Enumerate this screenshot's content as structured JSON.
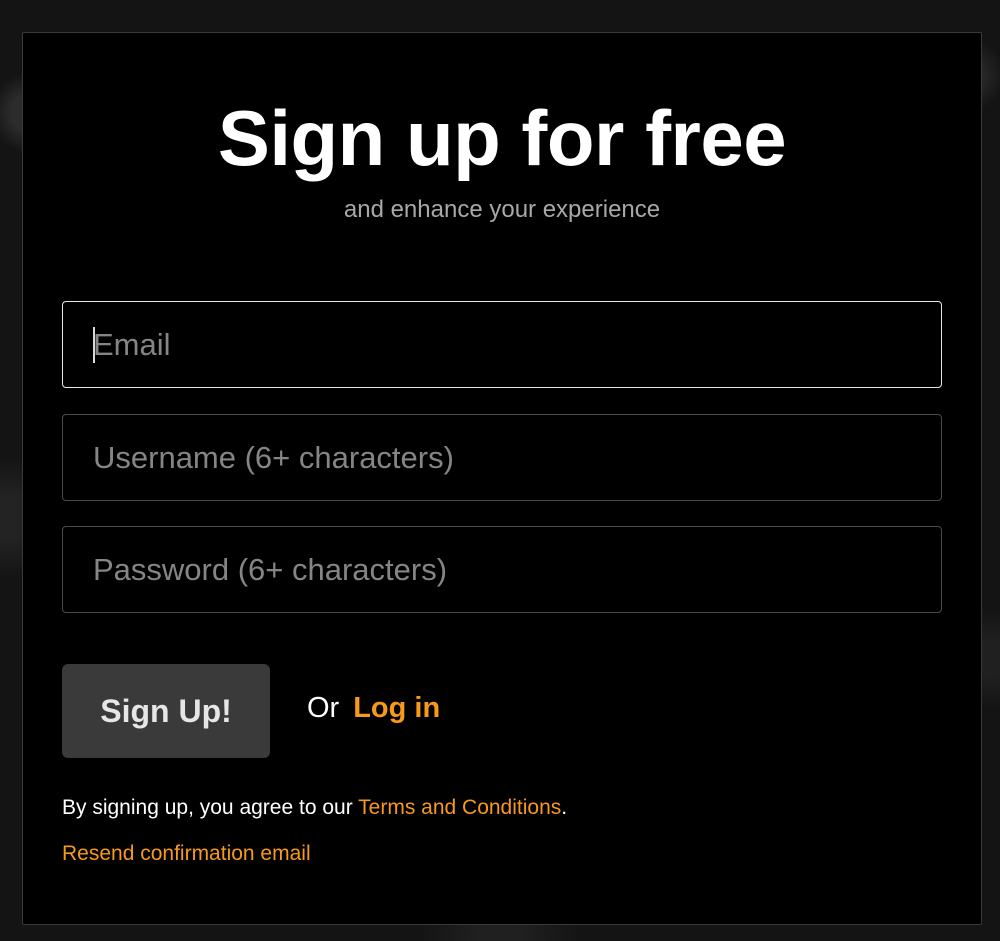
{
  "heading": {
    "title": "Sign up for free",
    "subtitle": "and enhance your experience"
  },
  "form": {
    "email_placeholder": "Email",
    "username_placeholder": "Username (6+ characters)",
    "password_placeholder": "Password (6+ characters)",
    "submit_label": "Sign Up!",
    "or_text": "Or",
    "login_label": "Log in"
  },
  "footer": {
    "terms_prefix": "By signing up, you agree to our ",
    "terms_link": "Terms and Conditions",
    "terms_suffix": ".",
    "resend_label": "Resend confirmation email"
  },
  "colors": {
    "accent": "#f7991c",
    "background": "#000000",
    "button": "#3a3a3a"
  }
}
